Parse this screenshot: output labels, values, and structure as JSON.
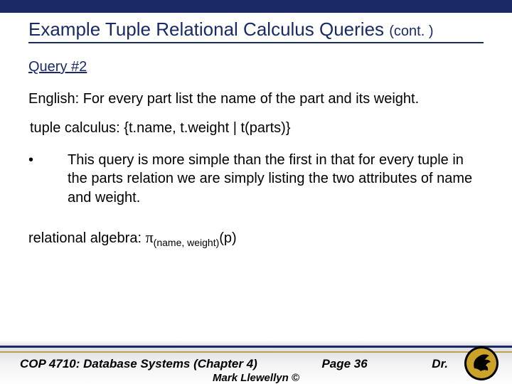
{
  "title_main": "Example Tuple Relational Calculus Queries ",
  "title_cont": "(cont. )",
  "query_label": "Query #2",
  "english_label": "English:",
  "english_text": "  For every part list the name of the part and its weight.",
  "tc_label": " tuple calculus:",
  "tc_text": "  {t.name, t.weight | t(parts)}",
  "bullet_marker": "•",
  "bullet_text": "This query is more simple than the first in that for every tuple in the parts relation we are simply listing the two attributes of name and weight.",
  "ra_label": "relational algebra:  ",
  "ra_pi": "π",
  "ra_sub": "(name, weight)",
  "ra_arg": "(p)",
  "footer_course": "COP 4710: Database Systems  (Chapter 4)",
  "footer_page": "Page 36",
  "footer_author": "Dr.",
  "footer_credit": "Mark Llewellyn ©"
}
